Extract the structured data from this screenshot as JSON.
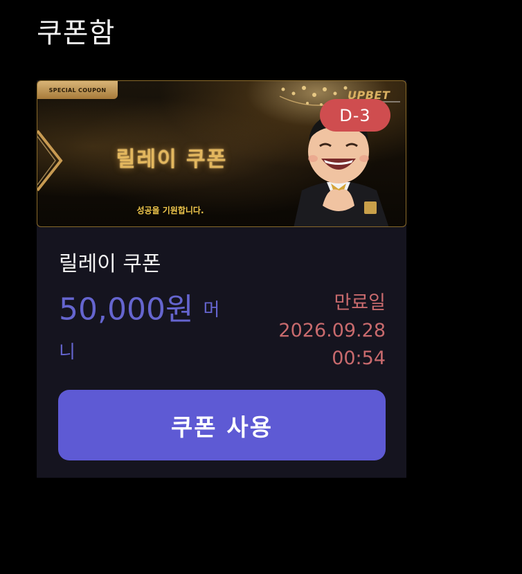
{
  "page": {
    "title": "쿠폰함"
  },
  "coupon": {
    "banner": {
      "tag": "SPECIAL COUPON",
      "title": "릴레이 쿠폰",
      "subtitle": "성공을 기원합니다.",
      "brand": "UPBET",
      "d_day": "D-3"
    },
    "name": "릴레이 쿠폰",
    "amount": "50,000원",
    "amount_unit_line1": "머",
    "amount_unit_line2": "니",
    "expiry": {
      "label": "만료일",
      "date": "2026.09.28",
      "time": "00:54"
    },
    "use_button_label": "쿠폰 사용"
  },
  "colors": {
    "background": "#000000",
    "card": "#15141f",
    "accent": "#5e5ad4",
    "amount": "#6565cf",
    "expiry": "#c86a6d",
    "badge": "#cf4d4f"
  }
}
